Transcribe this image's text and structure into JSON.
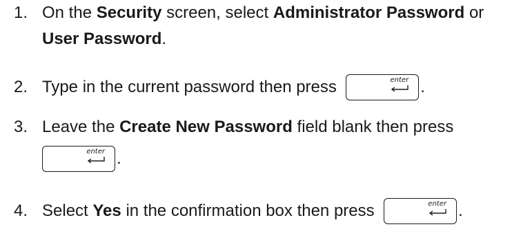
{
  "steps": [
    {
      "number": "1.",
      "line1": {
        "a": "On the ",
        "b": "Security",
        "c": " screen, select ",
        "d": "Administrator Password",
        "e": " or"
      },
      "line2": {
        "a": "User Password",
        "b": "."
      }
    },
    {
      "number": "2.",
      "text": "Type in the current password then press",
      "after_key": "."
    },
    {
      "number": "3.",
      "line1": {
        "a": "Leave the ",
        "b": "Create New Password",
        "c": " field blank then press"
      },
      "after_key": "."
    },
    {
      "number": "4.",
      "a": "Select ",
      "b": "Yes",
      "c": " in the confirmation box then press",
      "after_key": "."
    }
  ],
  "key": {
    "label": "enter",
    "icon": "enter-return-arrow-icon"
  }
}
